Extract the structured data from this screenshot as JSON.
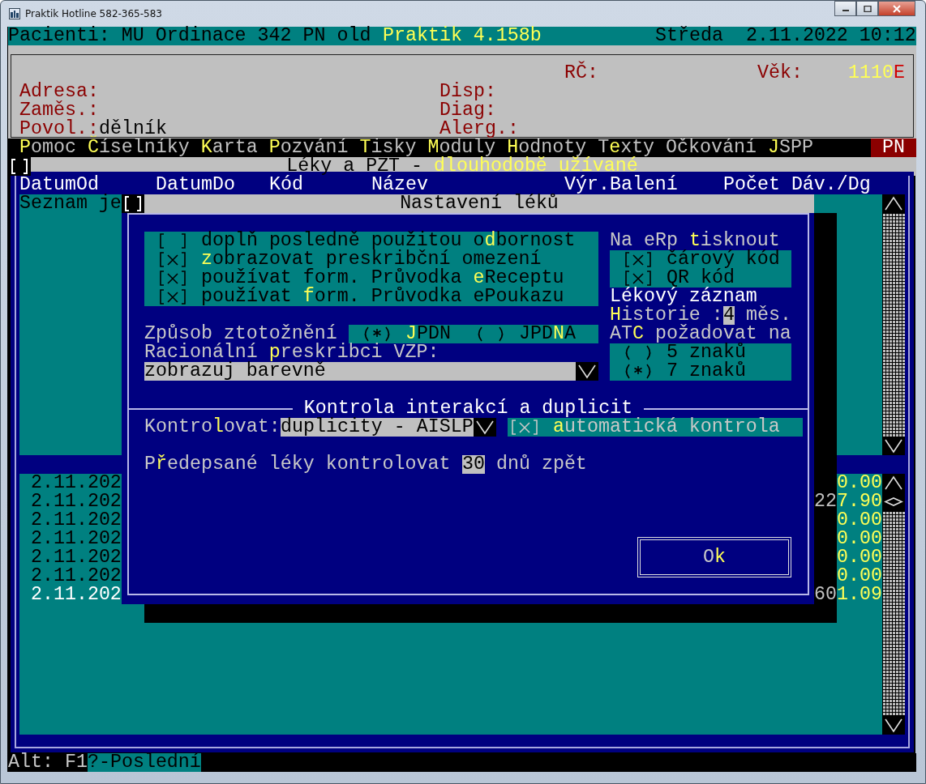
{
  "window": {
    "title": "Praktik Hotline 582-365-583"
  },
  "header": {
    "info": "Pacienti: MU Ordinace 342 PN old",
    "version": "Praktik 4.158b",
    "day": "Středa",
    "datetime": "2.11.2022 10:12"
  },
  "patient": {
    "rc_label": "RČ:",
    "age_label": "Věk:",
    "code": "1110",
    "code_suffix": "E",
    "fields": [
      {
        "label": "Adresa:"
      },
      {
        "label": "Zaměs.:"
      },
      {
        "label": "Povol.:",
        "value": "dělník"
      }
    ],
    "side_labels": [
      "Disp:",
      "Diag:",
      "Alerg.:"
    ]
  },
  "menu": {
    "items": [
      "**P**omoc",
      "**Č**íselníky",
      "**K**arta",
      "**P**ozvání",
      "**T**isky",
      "**M**oduly",
      "**H**odnoty",
      "T**e**xty",
      "Očkování",
      "**J**SPP"
    ],
    "badge": "PN"
  },
  "list": {
    "title": "Léky a PZT -",
    "title_highlight": "dlouhodobě užívané",
    "columns": [
      "DatumOd",
      "DatumDo",
      "Kód",
      "Název",
      "Výr.Balení",
      "Počet Dáv./Dg"
    ],
    "note": "Seznam je",
    "rows": [
      {
        "date": "2.11.202",
        "value": "0.00",
        "selected": false
      },
      {
        "date": "2.11.202",
        "covered": "22",
        "value": "7.90",
        "selected": false
      },
      {
        "date": "2.11.202",
        "value": "0.00",
        "selected": false
      },
      {
        "date": "2.11.202",
        "value": "0.00",
        "selected": false
      },
      {
        "date": "2.11.202",
        "value": "0.00",
        "selected": false
      },
      {
        "date": "2.11.202",
        "value": "0.00",
        "selected": false
      },
      {
        "date": "2.11.202",
        "covered": "60",
        "value": "1.09",
        "selected": true
      }
    ]
  },
  "dialog": {
    "title": "Nastavení léků",
    "options": [
      {
        "label": "doplň posledně použitou o**d**bornost",
        "checked": false
      },
      {
        "label": "**z**obrazovat preskribční omezení",
        "checked": true
      },
      {
        "label": "používat form. Průvodka **e**Receptu",
        "checked": true
      },
      {
        "label": "používat **f**orm. Průvodka ePoukazu",
        "checked": true
      }
    ],
    "print": {
      "label": "Na eRp **t**isknout",
      "options": [
        {
          "label": "čárový kód",
          "checked": true
        },
        {
          "label": "QR kód",
          "checked": true
        }
      ]
    },
    "record": {
      "title": "Lékový záznam",
      "history_label": "**H**istorie :",
      "history_value": "4",
      "history_unit": "měs."
    },
    "identification": {
      "label": "Způsob ztotožnění",
      "options": [
        {
          "label": "**J**PDN",
          "selected": true
        },
        {
          "label": "JPD**N**A",
          "selected": false
        }
      ]
    },
    "atc": {
      "label": "AT**C** požadovat na",
      "options": [
        {
          "label": "5 znaků",
          "selected": false
        },
        {
          "label": "7 znaků",
          "selected": true
        }
      ]
    },
    "rational": {
      "label": "Racionální **p**reskribci VZP:",
      "value": "zobrazuj barevně"
    },
    "interactions": {
      "title": "Kontrola interakcí a duplicit",
      "check_label": "Kontro**l**ovat:",
      "check_value": "duplicity - AISLP",
      "auto": {
        "label": "**a**utomatická kontrola",
        "checked": true
      },
      "days_before": "P**ř**edepsané léky kontrolovat",
      "days": "30",
      "days_after": "dnů zpět"
    },
    "ok": "O**k**"
  },
  "status": {
    "keys": "Alt: F1",
    "hint": "?-Poslední"
  }
}
